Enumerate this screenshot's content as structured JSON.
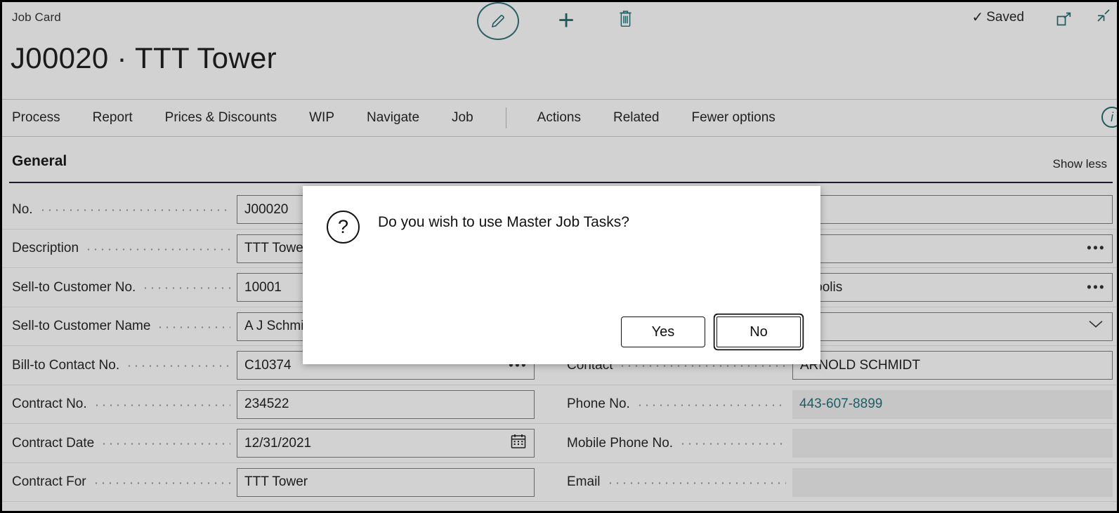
{
  "window": {
    "breadcrumb": "Job Card",
    "page_title": "J00020 · TTT Tower",
    "status_text": "Saved",
    "check_glyph": "✓",
    "plus_glyph": "+",
    "accent_color": "#1c5c5c",
    "background_color": "#d2d2d2"
  },
  "toolbar": {
    "edit_icon": "pencil-icon",
    "new_icon": "plus-icon",
    "delete_icon": "trash-icon",
    "open_new_window_icon": "open-in-new-window-icon",
    "expand_icon": "expand-icon"
  },
  "menu": {
    "items": [
      {
        "label": "Process"
      },
      {
        "label": "Report"
      },
      {
        "label": "Prices & Discounts"
      },
      {
        "label": "WIP"
      },
      {
        "label": "Navigate"
      },
      {
        "label": "Job"
      }
    ],
    "items2": [
      {
        "label": "Actions"
      },
      {
        "label": "Related"
      },
      {
        "label": "Fewer options"
      }
    ],
    "info_glyph": "i"
  },
  "section": {
    "title": "General",
    "toggle_label": "Show less"
  },
  "form": {
    "rows": [
      {
        "left": {
          "label": "No.",
          "value": "J00020",
          "control": "input",
          "readonly": false
        },
        "right": {
          "label": "",
          "value": "",
          "control": "input",
          "readonly": false
        }
      },
      {
        "left": {
          "label": "Description",
          "value": "TTT Tower",
          "control": "input",
          "readonly": false
        },
        "right": {
          "label": "",
          "value": "",
          "control": "assist",
          "readonly": false
        }
      },
      {
        "left": {
          "label": "Sell-to Customer No.",
          "value": "10001",
          "control": "input",
          "readonly": false
        },
        "right": {
          "label": "",
          "value": "napolis",
          "control": "assist",
          "readonly": false
        }
      },
      {
        "left": {
          "label": "Sell-to Customer Name",
          "value": "A J Schmidt",
          "control": "input",
          "readonly": false
        },
        "right": {
          "label": "",
          "value": "",
          "control": "dropdown",
          "readonly": false
        }
      },
      {
        "left": {
          "label": "Bill-to Contact No.",
          "value": "C10374",
          "control": "assist",
          "readonly": false
        },
        "right": {
          "label": "Contact",
          "value": "ARNOLD SCHMIDT",
          "control": "input",
          "readonly": false
        }
      },
      {
        "left": {
          "label": "Contract No.",
          "value": "234522",
          "control": "input",
          "readonly": false
        },
        "right": {
          "label": "Phone No.",
          "value": "443-607-8899",
          "control": "link",
          "readonly": true
        }
      },
      {
        "left": {
          "label": "Contract Date",
          "value": "12/31/2021",
          "control": "date",
          "readonly": false
        },
        "right": {
          "label": "Mobile Phone No.",
          "value": "",
          "control": "input",
          "readonly": true
        }
      },
      {
        "left": {
          "label": "Contract For",
          "value": "TTT Tower",
          "control": "input",
          "readonly": false
        },
        "right": {
          "label": "Email",
          "value": "",
          "control": "input",
          "readonly": true
        }
      }
    ],
    "assist_glyph": "•••"
  },
  "dialog": {
    "question_glyph": "?",
    "message": "Do you wish to use Master Job Tasks?",
    "yes_label": "Yes",
    "no_label": "No",
    "focused_button": "No"
  }
}
